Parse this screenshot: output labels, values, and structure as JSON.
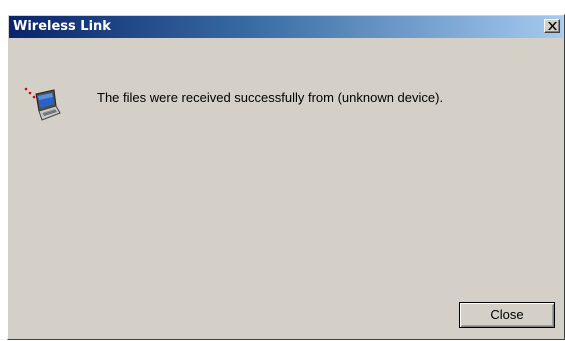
{
  "window": {
    "title": "Wireless Link",
    "close_icon": "close-icon"
  },
  "dialog": {
    "icon": "laptop-infrared-icon",
    "message": "The files were received successfully from (unknown device).",
    "close_label": "Close"
  },
  "colors": {
    "title_gradient_start": "#0a246a",
    "title_gradient_end": "#a6caf0",
    "dialog_background": "#d4d0c8"
  }
}
